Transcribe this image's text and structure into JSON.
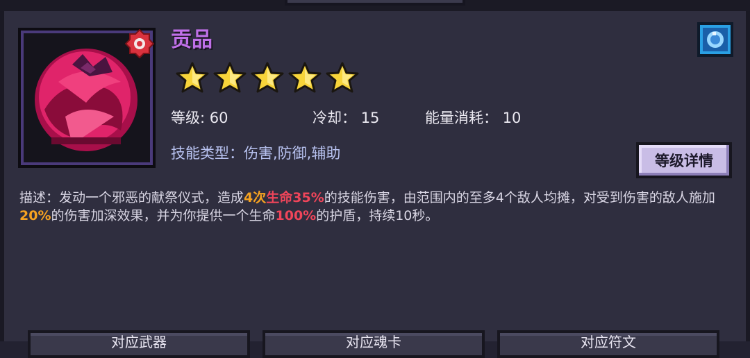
{
  "skill": {
    "name": "贡品",
    "stars": 5,
    "colors": {
      "name": "#c070e8",
      "orange_highlight": "#f6a321",
      "red_highlight": "#f0455a"
    },
    "icon": "crimson-orb-skill-icon",
    "badge_icon": "red-badge-icon",
    "gem_icon": "blue-gem-icon"
  },
  "stats": {
    "level_label": "等级:",
    "level_value": "60",
    "cooldown_label": "冷却：",
    "cooldown_value": "15",
    "energy_label": "能量消耗：",
    "energy_value": "10"
  },
  "type_line": "技能类型：伤害,防御,辅助",
  "detail_button": "等级详情",
  "description": {
    "p1": "描述：发动一个邪恶的献祭仪式，造成",
    "h1": "4次",
    "p2": "",
    "h2": "生命35%",
    "p3": "的技能伤害，由范围内的至多4个敌人均摊，对受到伤害的敌人施加",
    "h3": "20%",
    "p4": "的伤害加深效果，并为你提供一个生命",
    "h4": "100%",
    "p5": "的护盾，持续10秒。"
  },
  "bottom_buttons": [
    "对应武器",
    "对应魂卡",
    "对应符文"
  ]
}
